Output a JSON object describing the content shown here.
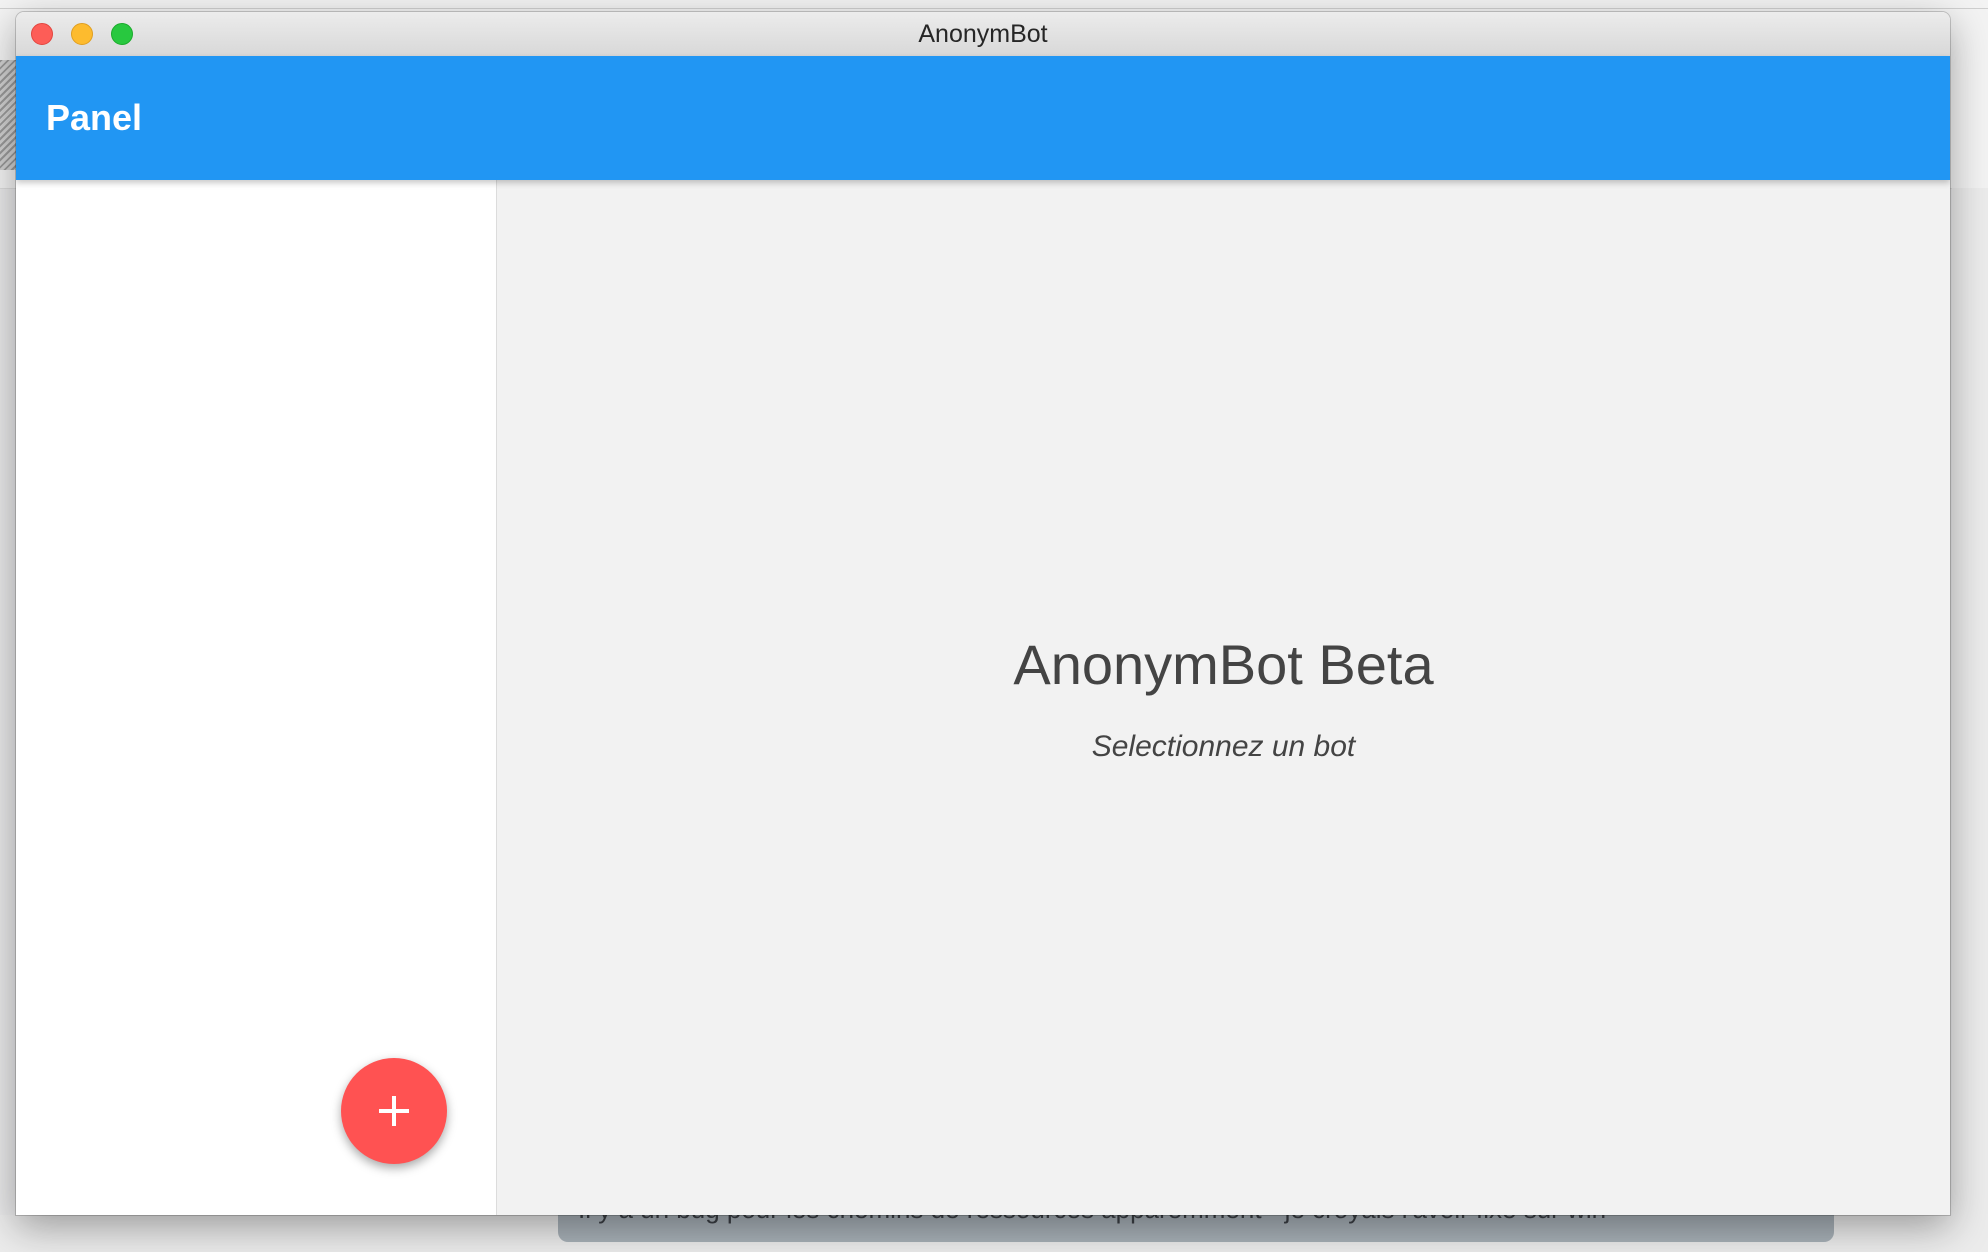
{
  "window": {
    "title": "AnonymBot"
  },
  "appbar": {
    "title": "Panel",
    "color": "#2196f3"
  },
  "sidebar": {
    "fab": {
      "icon": "plus-icon",
      "color": "#ff5252"
    }
  },
  "main": {
    "title": "AnonymBot Beta",
    "subtitle": "Selectionnez un bot"
  },
  "background": {
    "chat_bubble_text": "Il y a un bug pour les chemins de ressources apparemment - je croyais l'avoir fixé sur win"
  }
}
